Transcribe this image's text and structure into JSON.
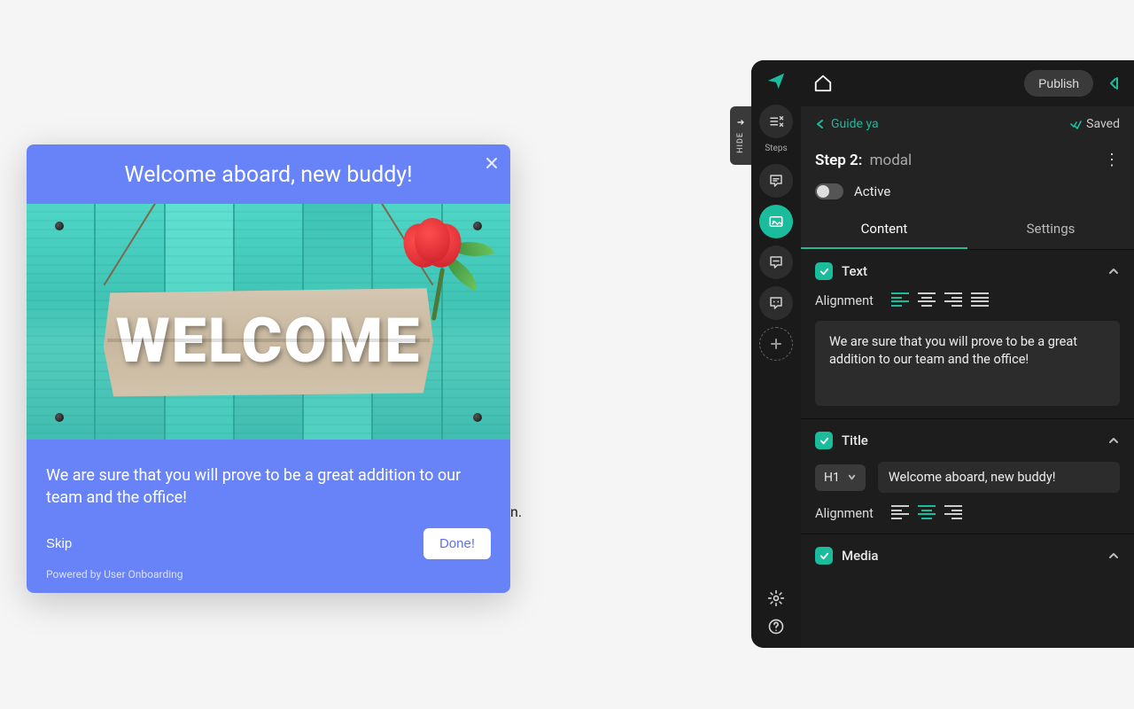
{
  "modal": {
    "title": "Welcome aboard, new buddy!",
    "sign_text": "WELCOME",
    "body": "We are sure that you will prove to be a great addition to our team and the office!",
    "skip_label": "Skip",
    "done_label": "Done!",
    "powered": "Powered by User Onboarding"
  },
  "behind": {
    "partial_text": "n."
  },
  "hide_tab": {
    "label": "HIDE"
  },
  "topbar": {
    "publish_label": "Publish"
  },
  "subhead": {
    "back_label": "Guide ya",
    "saved_label": "Saved"
  },
  "step": {
    "prefix": "Step 2:",
    "kind": "modal"
  },
  "active_row": {
    "label": "Active"
  },
  "tabs": {
    "content": "Content",
    "settings": "Settings"
  },
  "text_section": {
    "title": "Text",
    "alignment_label": "Alignment",
    "value": "We are sure that you will prove to be a great addition to our team and the office!"
  },
  "title_section": {
    "title": "Title",
    "heading_level": "H1",
    "value": "Welcome aboard, new buddy!",
    "alignment_label": "Alignment"
  },
  "media_section": {
    "title": "Media"
  },
  "rail": {
    "steps_label": "Steps"
  }
}
